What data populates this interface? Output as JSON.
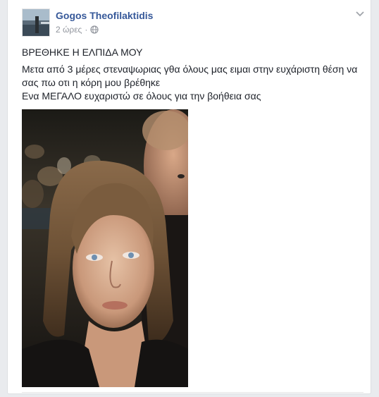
{
  "post": {
    "author_name": "Gogos Theofilaktidis",
    "timestamp": "2 ώρες",
    "separator": "·",
    "privacy_icon": "globe-icon",
    "options_icon": "chevron-down-icon",
    "heading": "ΒΡΕΘΗΚΕ Η ΕΛΠΙΔΑ ΜΟΥ",
    "body_line_1": "Μετα από 3 μέρες στεναψωριας γθα όλους μας ειμαι στην ευχάριστη θέση να σας πω οτι η κόρη μου βρέθηκε",
    "body_line_2": "Ενα ΜΕΓΑΛΟ ευχαριστώ σε όλους για την βοήθεια σας"
  },
  "colors": {
    "author_link": "#365899",
    "meta_text": "#90949c",
    "body_text": "#1d2129",
    "page_background": "#e9ebee"
  }
}
